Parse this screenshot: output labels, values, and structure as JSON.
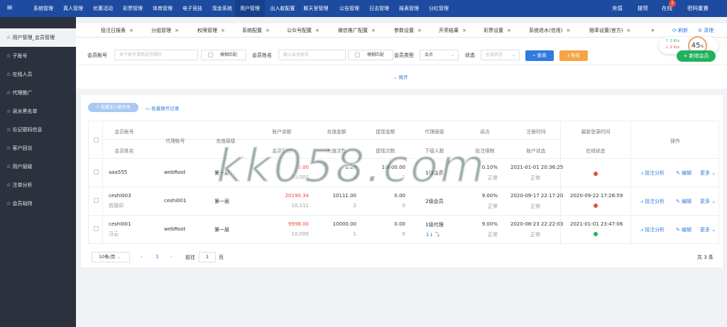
{
  "topbar": {
    "menu_icon": "≡",
    "nav": [
      "系统管理",
      "真人管理",
      "优惠活动",
      "彩票管理",
      "体育管理",
      "电子竞技",
      "现金系统",
      "用户管理",
      "出入款配置",
      "聊天室管理",
      "公告管理",
      "日志管理",
      "报表管理",
      "分红管理"
    ],
    "active_nav": "用户管理",
    "right": {
      "recharge": "充值",
      "withdraw": "提现",
      "online": "在线",
      "online_badge": "2",
      "pwd_reset": "密码重置"
    }
  },
  "sidebar": {
    "items": [
      "用户管理_会员管理",
      "子账号",
      "在线人员",
      "代理推广",
      "返水黑名单",
      "忘记密码信息",
      "客户回访",
      "用户层级",
      "注单分析",
      "会员劫持"
    ],
    "active_index": 0
  },
  "tabs": {
    "items": [
      "投注日报表",
      "分组管理",
      "权限管理",
      "系统配置",
      "公众号配置",
      "微信推广配置",
      "参数设置",
      "开奖结果",
      "彩票设置",
      "系统退水(信用)",
      "赔率设置(官方)"
    ],
    "close": "×",
    "more": "»",
    "refresh": "刷新",
    "clear": "清理"
  },
  "speed_widget": {
    "up": "1 K/s",
    "down": "2 K/s",
    "percent": "45",
    "unit": "%"
  },
  "add_button": "+ 新增会员",
  "filters": {
    "member_account_label": "会员帐号",
    "member_account_placeholder": "多个帐号请用逗号隔开",
    "fuzzy_label": "模糊匹配",
    "member_name_label": "会员姓名",
    "member_name_placeholder": "输入会员姓名",
    "member_type_label": "会员类型",
    "member_type_value": "会员",
    "status_label": "状态",
    "status_placeholder": "全部状态",
    "query_button": "查询",
    "export_button": "导出",
    "expand": "展开"
  },
  "actions": {
    "batch_chat": "批量加入聊天室",
    "batch_log": "批量操作记录"
  },
  "table": {
    "headers": [
      [
        "会员帐号",
        "会员姓名"
      ],
      [
        "代理帐号"
      ],
      [
        "充值层级"
      ],
      [
        "账户余额",
        "会员积分"
      ],
      [
        "充值金额",
        "充值次数"
      ],
      [
        "提现金额",
        "提现次数"
      ],
      [
        "代理层级",
        "下级人数"
      ],
      [
        "返点",
        "投注限制"
      ],
      [
        "注册时间",
        "账户状态"
      ],
      [
        "最新登录时间",
        "在线状态"
      ],
      [
        "操作"
      ]
    ],
    "rows": [
      {
        "account": "aaa555",
        "name": "",
        "agent": "webRoot",
        "level": "第一层",
        "balance": "0.00",
        "points": "-10,000",
        "recharge_amt": "0.00",
        "recharge_cnt": "0",
        "withdraw_amt": "10000.00",
        "withdraw_cnt": "1",
        "agent_level": "1级会员",
        "sub_count": "",
        "rebate": "0.10%",
        "bet_limit": "正常",
        "reg_time": "2021-01-01 20:36:25",
        "acct_status": "正常",
        "last_login": "",
        "online": "red"
      },
      {
        "account": "ceshi003",
        "name": "而我却",
        "agent": "ceshi001",
        "level": "第一层",
        "balance": "20190.34",
        "points": "10,111",
        "recharge_amt": "10111.00",
        "recharge_cnt": "2",
        "withdraw_amt": "0.00",
        "withdraw_cnt": "0",
        "agent_level": "2级会员",
        "sub_count": "",
        "rebate": "9.00%",
        "bet_limit": "正常",
        "reg_time": "2020-09-17 22:17:20",
        "acct_status": "正常",
        "last_login": "2020-09-22 17:26:59",
        "online": "red"
      },
      {
        "account": "ceshi001",
        "name": "马云",
        "agent": "webRoot",
        "level": "第一层",
        "balance": "9998.00",
        "points": "10,000",
        "recharge_amt": "10000.00",
        "recharge_cnt": "1",
        "withdraw_amt": "0.00",
        "withdraw_cnt": "0",
        "agent_level": "1级代理",
        "sub_count": "1",
        "rebate": "9.00%",
        "bet_limit": "正常",
        "reg_time": "2020-08-23 22:22:03",
        "acct_status": "正常",
        "last_login": "2021-01-01 23:47:06",
        "online": "green"
      }
    ],
    "op_labels": {
      "analysis": "投注分析",
      "edit": "编辑",
      "more": "更多"
    }
  },
  "pagination": {
    "page_size": "10条/页",
    "current": "1",
    "goto_label": "前往",
    "goto_value": "1",
    "page_unit": "页",
    "total": "共 3 条"
  },
  "watermark": "kk058.com",
  "colors": {
    "topbar": "#1c4ba0",
    "sidebar": "#2b313d",
    "primary": "#2f7bdf",
    "warning": "#f5a546",
    "success": "#20b15c",
    "danger": "#e64c3c"
  }
}
